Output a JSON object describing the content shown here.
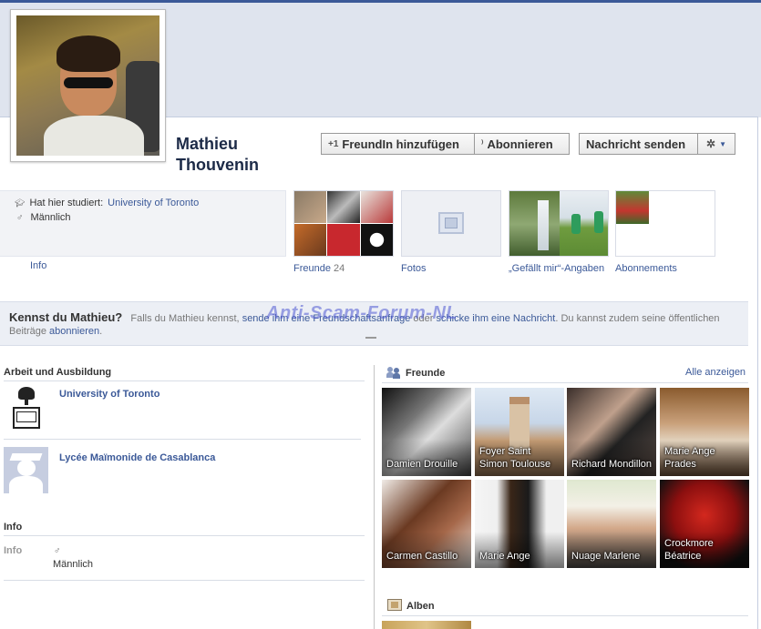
{
  "profile": {
    "name_first": "Mathieu",
    "name_last": "Thouvenin"
  },
  "actions": {
    "add_friend": "FreundIn hinzufügen",
    "subscribe": "Abonnieren",
    "message": "Nachricht senden"
  },
  "info_box": {
    "studied_prefix": "Hat hier studiert:",
    "studied_link": "University of Toronto",
    "gender": "Männlich",
    "info_link": "Info"
  },
  "tiles": {
    "friends_label": "Freunde",
    "friends_count": "24",
    "photos_label": "Fotos",
    "likes_label": "„Gefällt mir“-Angaben",
    "subs_label": "Abonnements"
  },
  "kennst": {
    "title": "Kennst du Mathieu?",
    "text1": "Falls du Mathieu kennst,",
    "link1": "sende ihm eine Freundschaftsanfrage",
    "text2": "oder",
    "link2": "schicke ihm eine Nachricht",
    "text3": ". Du kannst zudem seine öffentlichen",
    "text4": "Beiträge",
    "link3": "abonnieren",
    "text5": "."
  },
  "watermark": "Anti-Scam-Forum-NL",
  "work": {
    "heading": "Arbeit und Ausbildung",
    "items": [
      "University of Toronto",
      "Lycée Maïmonide de Casablanca"
    ]
  },
  "info_section": {
    "heading": "Info",
    "label": "Info",
    "value": "Männlich"
  },
  "friends": {
    "heading": "Freunde",
    "see_all": "Alle anzeigen",
    "list": [
      "Damien Drouille",
      "Foyer Saint Simon Toulouse",
      "Richard Mondillon",
      "Marie Ange Prades",
      "Carmen Castillo",
      "Marie Ange",
      "Nuage Marlene",
      "Crockmore Béatrice"
    ]
  },
  "albums": {
    "heading": "Alben"
  }
}
